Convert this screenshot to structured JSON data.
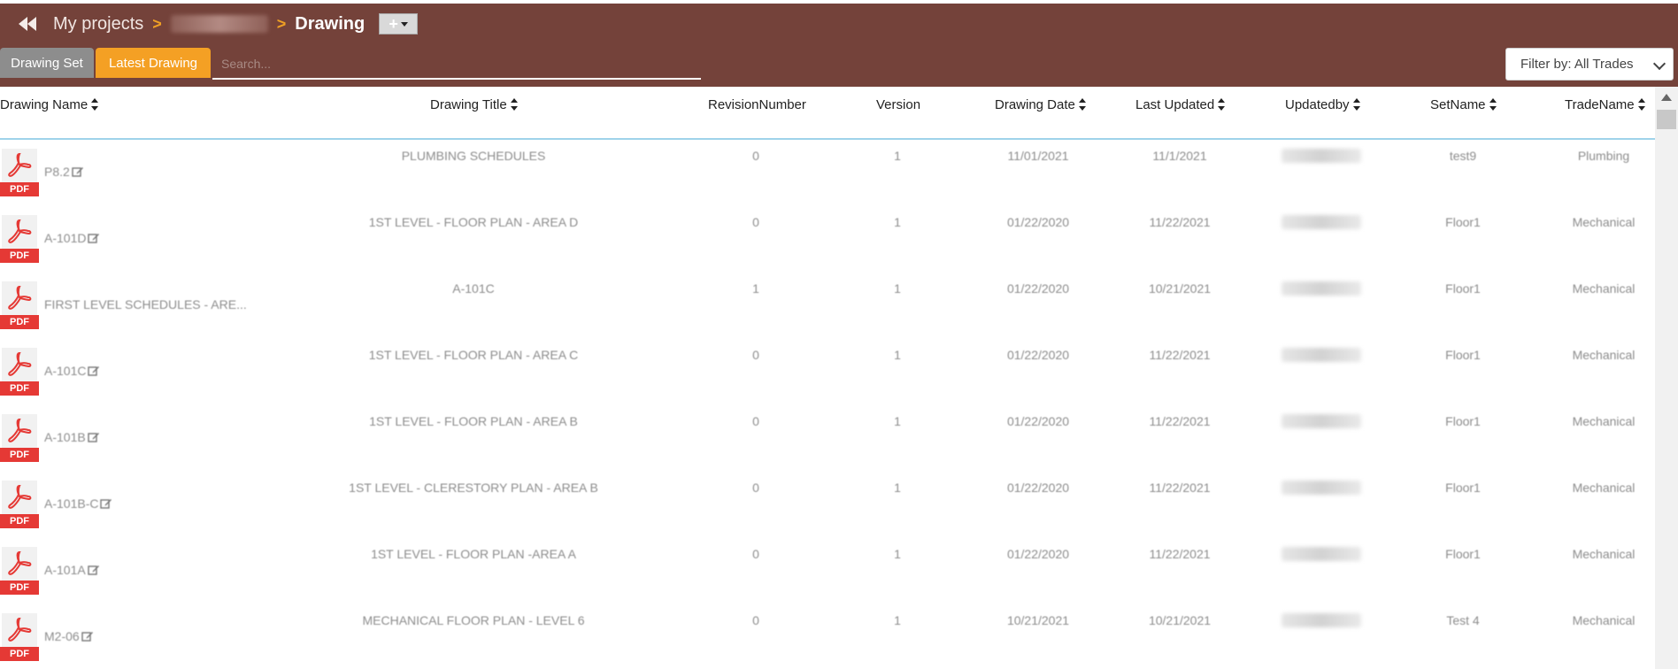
{
  "breadcrumb": {
    "my_projects": "My projects",
    "separator": ">",
    "current": "Drawing",
    "add_label": "+"
  },
  "tabs": [
    {
      "label": "Drawing Set",
      "active": false
    },
    {
      "label": "Latest Drawing",
      "active": true
    }
  ],
  "search": {
    "placeholder": "Search...",
    "value": ""
  },
  "filter": {
    "label": "Filter by: All Trades"
  },
  "columns": [
    {
      "label": "Drawing Name",
      "sortable": true
    },
    {
      "label": "Drawing Title",
      "sortable": true
    },
    {
      "label": "RevisionNumber",
      "sortable": false
    },
    {
      "label": "Version",
      "sortable": false
    },
    {
      "label": "Drawing Date",
      "sortable": true
    },
    {
      "label": "Last Updated",
      "sortable": true
    },
    {
      "label": "Updatedby",
      "sortable": true
    },
    {
      "label": "SetName",
      "sortable": true
    },
    {
      "label": "TradeName",
      "sortable": true
    }
  ],
  "rows": [
    {
      "name": "P8.2",
      "editable": true,
      "title": "PLUMBING SCHEDULES",
      "revision": "0",
      "version": "1",
      "drawing_date": "11/01/2021",
      "last_updated": "11/1/2021",
      "set": "test9",
      "trade": "Plumbing"
    },
    {
      "name": "A-101D",
      "editable": true,
      "title": "1ST LEVEL - FLOOR PLAN - AREA D",
      "revision": "0",
      "version": "1",
      "drawing_date": "01/22/2020",
      "last_updated": "11/22/2021",
      "set": "Floor1",
      "trade": "Mechanical"
    },
    {
      "name": "FIRST LEVEL SCHEDULES - ARE...",
      "editable": false,
      "title": "A-101C",
      "revision": "1",
      "version": "1",
      "drawing_date": "01/22/2020",
      "last_updated": "10/21/2021",
      "set": "Floor1",
      "trade": "Mechanical"
    },
    {
      "name": "A-101C",
      "editable": true,
      "title": "1ST LEVEL - FLOOR PLAN - AREA C",
      "revision": "0",
      "version": "1",
      "drawing_date": "01/22/2020",
      "last_updated": "11/22/2021",
      "set": "Floor1",
      "trade": "Mechanical"
    },
    {
      "name": "A-101B",
      "editable": true,
      "title": "1ST LEVEL - FLOOR PLAN - AREA B",
      "revision": "0",
      "version": "1",
      "drawing_date": "01/22/2020",
      "last_updated": "11/22/2021",
      "set": "Floor1",
      "trade": "Mechanical"
    },
    {
      "name": "A-101B-C",
      "editable": true,
      "title": "1ST LEVEL - CLERESTORY PLAN - AREA B",
      "revision": "0",
      "version": "1",
      "drawing_date": "01/22/2020",
      "last_updated": "11/22/2021",
      "set": "Floor1",
      "trade": "Mechanical"
    },
    {
      "name": "A-101A",
      "editable": true,
      "title": "1ST LEVEL - FLOOR PLAN -AREA A",
      "revision": "0",
      "version": "1",
      "drawing_date": "01/22/2020",
      "last_updated": "11/22/2021",
      "set": "Floor1",
      "trade": "Mechanical"
    },
    {
      "name": "M2-06",
      "editable": true,
      "title": "MECHANICAL FLOOR PLAN - LEVEL 6",
      "revision": "0",
      "version": "1",
      "drawing_date": "10/21/2021",
      "last_updated": "10/21/2021",
      "set": "Test 4",
      "trade": "Mechanical"
    }
  ],
  "file_badge": "PDF",
  "icons": {
    "back": "double-chevron-left-icon",
    "edit": "edit-icon",
    "file": "pdf-file-icon",
    "sort": "sort-icon"
  },
  "colors": {
    "header_bg": "#74423a",
    "accent": "#f4a024",
    "tab_inactive": "#8d8d8d",
    "pdf_red": "#e53935",
    "divider": "#9fd3ea"
  }
}
